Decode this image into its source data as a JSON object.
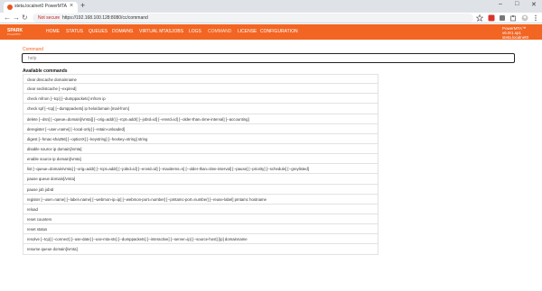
{
  "browser": {
    "tab_title": "steta.localnet0 PowerMTA Monitor",
    "tab_close": "×",
    "new_tab": "+",
    "nav_back": "←",
    "nav_forward": "→",
    "nav_reload": "↻",
    "security_label": "Not secure",
    "url": "https://192.168.100.128:8080/cc/command",
    "window_controls": {
      "minimize": "–",
      "maximize": "□",
      "close": "✕"
    }
  },
  "app": {
    "logo_main": "SPARK",
    "logo_sub": "PowerMTA",
    "nav": [
      "HOME",
      "STATUS",
      "QUEUES",
      "DOMAINS",
      "VIRTUAL MTAS",
      "JOBS",
      "LOGS",
      "COMMAND",
      "LICENSE",
      "CONFIGURATION"
    ],
    "active_nav": "COMMAND",
    "version_line1": "PowerMTA™ v6.0r1.sp1",
    "version_line2": "steta.localnet0",
    "accent_color": "#f26522"
  },
  "page": {
    "label": "Command",
    "input_value": "help",
    "available_title": "Available commands",
    "commands": [
      "clear dnscache domainname",
      "clear seclistcache [--expired]",
      "check mfrom [--tcp] [--dumppackets] mfrom ip",
      "check spf [--tcp] [--dumppackets] ip helo/domain [mail-from]",
      "delete [--dsn] [--queue=domain[/vmta]] [--orig=addr] [--rcpt=addr] [--jobId=id] [--envId=id] [--older-than=time-interval] [--accounting]",
      "deregister [--user=name] [--local-only] [--retain-unloaded]",
      "digest [--hmac-sha256] [--optionX] [--keystring] [--hexkey=string] string",
      "disable source ip domain[/vmta]",
      "enable source ip domain[/vmta]",
      "list [--queue=domain/vmta] [--orig=addr] [--rcpt=addr] [--jobId=id] [--envId=id] [--maxitems=n] [--older-than=time-interval] [--pause] [--priority] [--schedule] [--greylisted]",
      "pause queue domain[/vmta]",
      "pause job jobId",
      "register [--user=name] [--label=name] [--webmon-ip=ip] [--webmon-port=number] [--pmtamc-port=number] [--reuse-label] pmtamc hostname",
      "reload",
      "reset counters",
      "reset status",
      "resolve [--tcp] [--connect] [--use-date] [--use-mta-sts] [--dumppackets] [--interactive] [--server=ip] [--source-host] [ip] domainname",
      "resume queue domain[/vmta]"
    ]
  }
}
